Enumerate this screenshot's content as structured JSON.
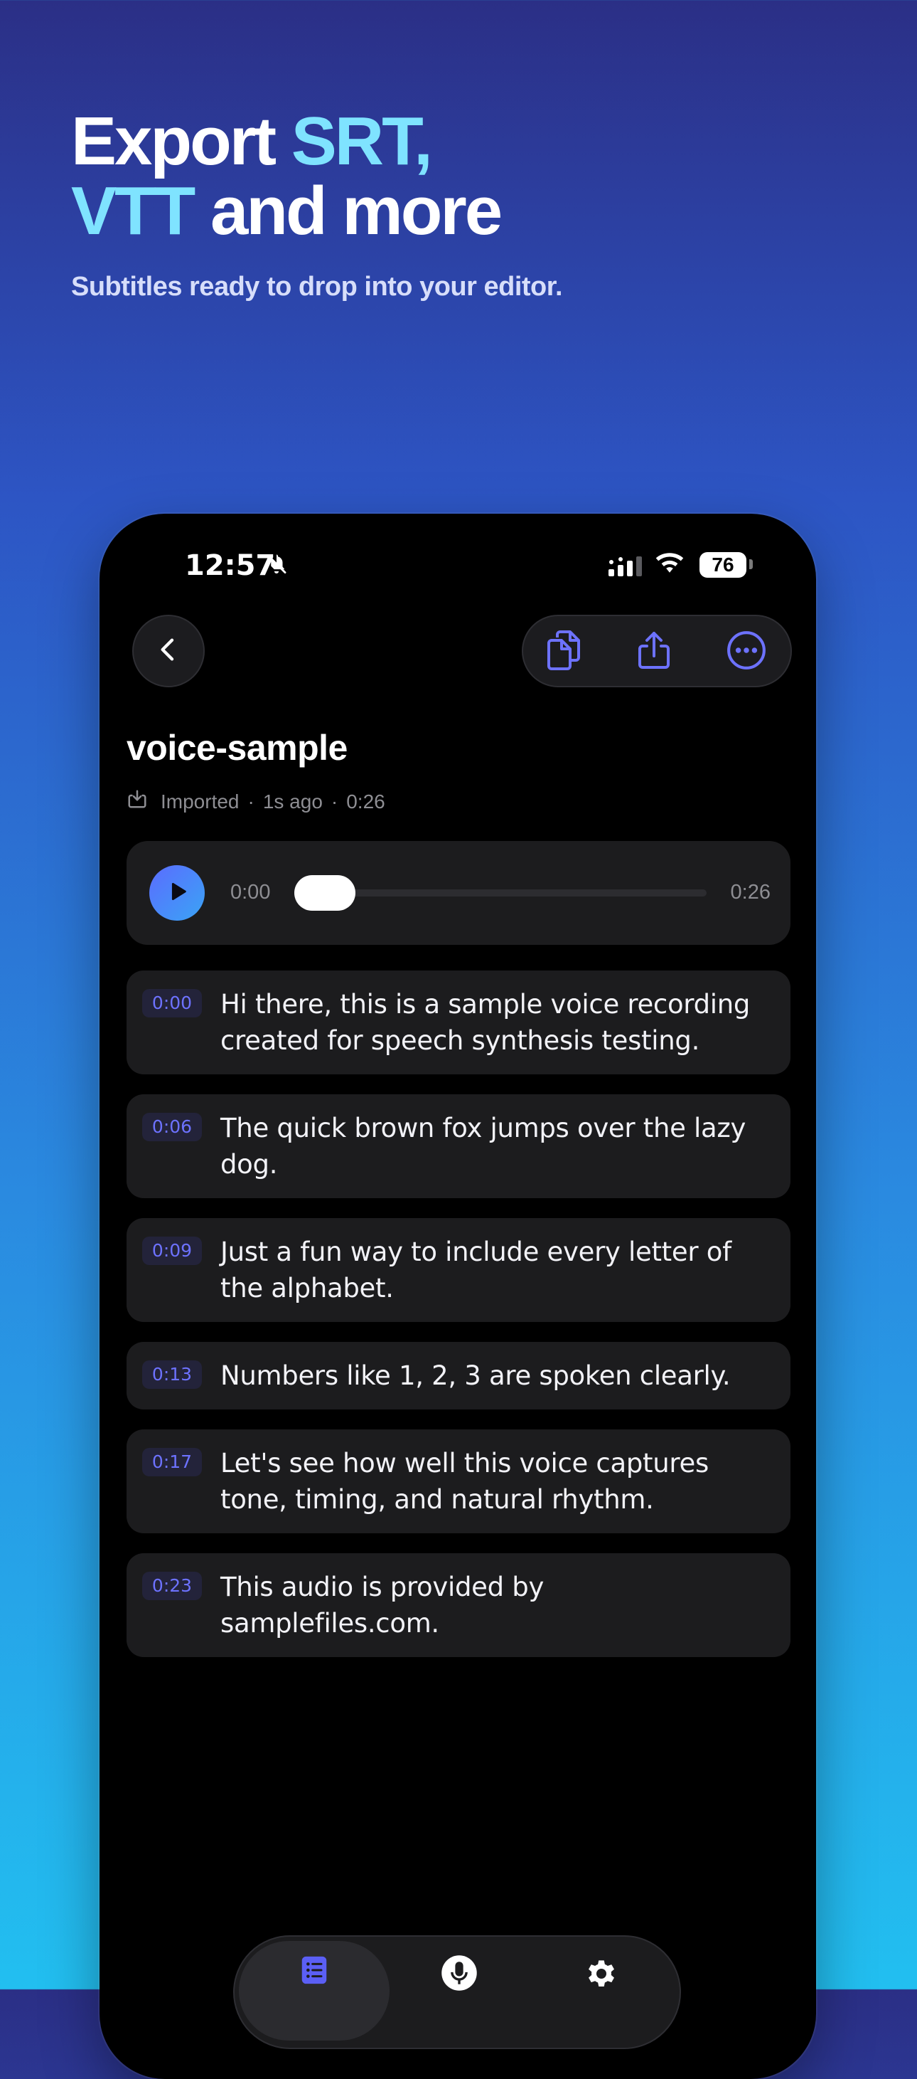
{
  "headline": {
    "line1_plain": "Export ",
    "line1_accent": "SRT,",
    "line2_accent": "VTT",
    "line2_plain": " and more",
    "subtitle": "Subtitles ready to drop into your editor."
  },
  "status_bar": {
    "time": "12:57",
    "battery": "76"
  },
  "recording": {
    "title": "voice-sample",
    "source": "Imported",
    "separator": "·",
    "age": "1s ago",
    "duration": "0:26"
  },
  "player": {
    "current": "0:00",
    "total": "0:26",
    "progress": 0
  },
  "segments": [
    {
      "time": "0:00",
      "text": "Hi there, this is a sample voice recording created for speech synthesis testing."
    },
    {
      "time": "0:06",
      "text": "The quick brown fox jumps over the lazy dog."
    },
    {
      "time": "0:09",
      "text": "Just a fun way to include every letter of the alphabet."
    },
    {
      "time": "0:13",
      "text": "Numbers like 1, 2, 3 are spoken clearly."
    },
    {
      "time": "0:17",
      "text": "Let's see how well this voice captures tone, timing, and natural rhythm."
    },
    {
      "time": "0:23",
      "text": "This audio is provided by samplefiles.com."
    }
  ],
  "icons": {
    "back": "chevron-left-icon",
    "copy": "copy-icon",
    "share": "share-icon",
    "more": "more-icon",
    "tabs": [
      "transcripts-icon",
      "microphone-icon",
      "settings-icon"
    ]
  },
  "colors": {
    "accent": "#6d72ff",
    "headline_accent": "#7fe3ff",
    "card": "#1c1c1e"
  }
}
